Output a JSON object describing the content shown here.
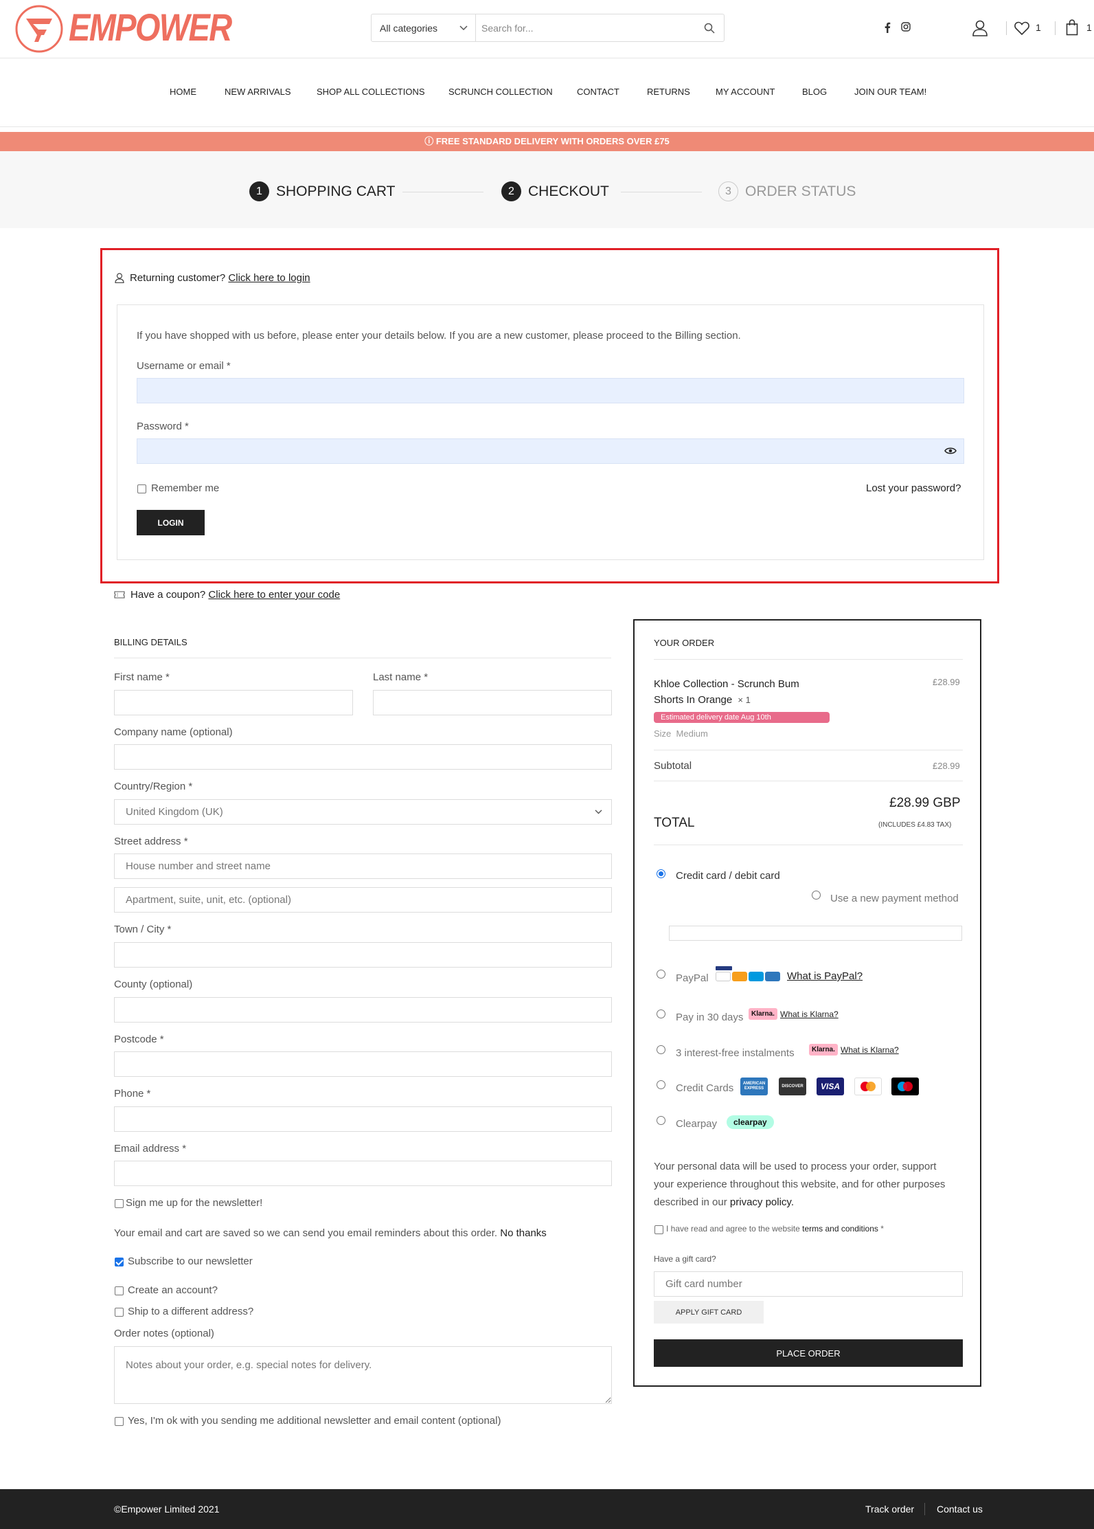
{
  "brand": {
    "logo_text": "EMPOWER",
    "accent": "#ee6f5f"
  },
  "search": {
    "category": "All categories",
    "placeholder": "Search for..."
  },
  "header": {
    "wishlist_count": "1",
    "cart_count": "1"
  },
  "nav": {
    "items": [
      "HOME",
      "NEW ARRIVALS",
      "SHOP ALL COLLECTIONS",
      "SCRUNCH COLLECTION",
      "CONTACT",
      "RETURNS",
      "MY ACCOUNT",
      "BLOG",
      "JOIN OUR TEAM!"
    ]
  },
  "banner": {
    "text": "ⓘ FREE STANDARD DELIVERY WITH ORDERS OVER £75"
  },
  "steps": [
    {
      "num": "1",
      "label": "SHOPPING CART"
    },
    {
      "num": "2",
      "label": "CHECKOUT"
    },
    {
      "num": "3",
      "label": "ORDER STATUS"
    }
  ],
  "login": {
    "returning_text": "Returning customer?",
    "login_link": "Click here to login",
    "intro": "If you have shopped with us before, please enter your details below. If you are a new customer, please proceed to the Billing section.",
    "username_label": "Username or email *",
    "password_label": "Password *",
    "remember_label": "Remember me",
    "lost_password": "Lost your password?",
    "button": "LOGIN"
  },
  "coupon": {
    "text": "Have a coupon?",
    "link": "Click here to enter your code"
  },
  "billing": {
    "title": "BILLING DETAILS",
    "first_name": "First name *",
    "last_name": "Last name *",
    "company": "Company name (optional)",
    "country_label": "Country/Region *",
    "country_value": "United Kingdom (UK)",
    "street_label": "Street address *",
    "street_placeholder": "House number and street name",
    "street2_placeholder": "Apartment, suite, unit, etc. (optional)",
    "town": "Town / City *",
    "county": "County (optional)",
    "postcode": "Postcode *",
    "phone": "Phone *",
    "email": "Email address *",
    "newsletter_signup": "Sign me up for the newsletter!",
    "cart_saved_text": "Your email and cart are saved so we can send you email reminders about this order.",
    "no_thanks": "No thanks",
    "subscribe": "Subscribe to our newsletter",
    "create_account": "Create an account?",
    "ship_different": "Ship to a different address?",
    "order_notes_label": "Order notes (optional)",
    "order_notes_placeholder": "Notes about your order, e.g. special notes for delivery.",
    "additional_newsletter": "Yes, I'm ok with you sending me additional newsletter and email content (optional)"
  },
  "order": {
    "title": "YOUR ORDER",
    "product_line1": "Khloe Collection - Scrunch Bum",
    "product_line2": "Shorts In Orange",
    "qty": "× 1",
    "product_price": "£28.99",
    "delivery_badge": "Estimated delivery date Aug 10th",
    "size_label": "Size",
    "size_value": "Medium",
    "subtotal_label": "Subtotal",
    "subtotal_value": "£28.99",
    "total_label": "TOTAL",
    "total_value": "£28.99 GBP",
    "tax_note": "(INCLUDES £4.83 TAX)",
    "payment_credit": "Credit card / debit card",
    "use_new_method": "Use a new payment method",
    "paypal": "PayPal",
    "paypal_link": "What is PayPal?",
    "pay30": "Pay in 30 days",
    "klarna_badge": "Klarna.",
    "klarna_link": "What is Klarna?",
    "instalments": "3 interest-free instalments",
    "credit_cards": "Credit Cards",
    "clearpay": "Clearpay",
    "clearpay_badge": "clearpay",
    "card_amex": "AMERICAN EXPRESS",
    "card_discover": "DISCOVER",
    "card_visa": "VISA",
    "privacy_text_1": "Your personal data will be used to process your order, support",
    "privacy_text_2": "your experience throughout this website, and for other purposes",
    "privacy_text_3": "described in our",
    "privacy_link": "privacy policy.",
    "terms_text": "I have read and agree to the website",
    "terms_link": "terms and conditions",
    "terms_star": "*",
    "gift_label": "Have a gift card?",
    "gift_placeholder": "Gift card number",
    "gift_button": "APPLY GIFT CARD",
    "place_order": "PLACE ORDER"
  },
  "footer": {
    "copyright": "©Empower Limited 2021",
    "track": "Track order",
    "contact": "Contact us"
  }
}
